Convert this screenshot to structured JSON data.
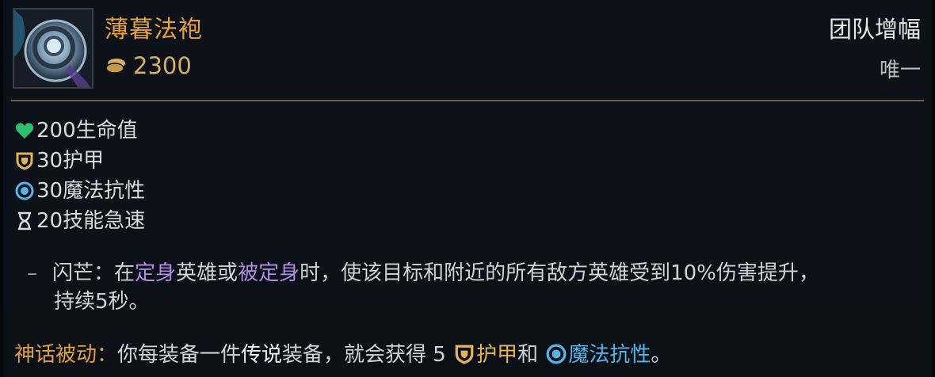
{
  "item": {
    "name": "薄暮法袍",
    "price": "2300",
    "category": "团队增幅",
    "uniqueness": "唯一"
  },
  "stats": [
    {
      "icon": "heart-icon",
      "text": "200生命值"
    },
    {
      "icon": "armor-shield-icon",
      "text": "30护甲"
    },
    {
      "icon": "magic-resist-icon",
      "text": "30魔法抗性"
    },
    {
      "icon": "hourglass-icon",
      "text": "20技能急速"
    }
  ],
  "passive": {
    "bullet": "–",
    "name": "闪芒：",
    "t1": "在",
    "k1": "定身",
    "t2": "英雄或",
    "k2": "被定身",
    "t3": "时，使该目标和附近的所有敌方英雄受到10%伤害提升，",
    "t4": "持续5秒。"
  },
  "mythic": {
    "label": "神话被动：",
    "t1": "你每装备一件",
    "k1": "传说",
    "t2": "装备，就会获得 5 ",
    "k2": "护甲",
    "t3": "和 ",
    "k3": "魔法抗性",
    "t4": "。"
  },
  "colors": {
    "title": "#e8a23a",
    "gold": "#d7b061",
    "keyword_purple": "#b08ee0",
    "keyword_blue": "#52b6ea",
    "heart": "#2fbf71",
    "divider": "#6f5f3c"
  }
}
